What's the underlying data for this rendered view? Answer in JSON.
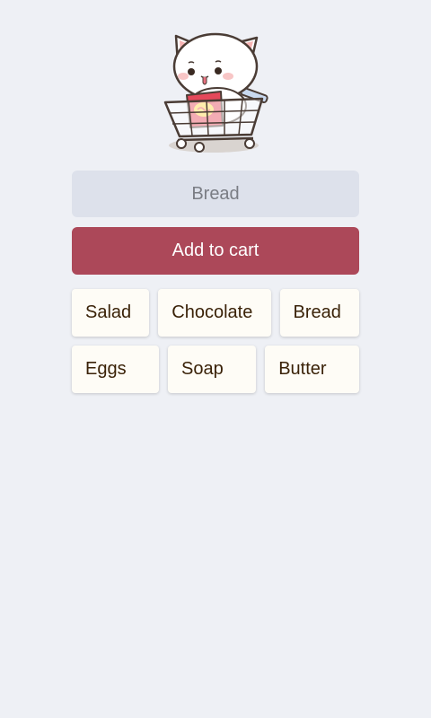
{
  "input": {
    "placeholder": "Bread",
    "value": ""
  },
  "add_button": {
    "label": "Add to cart"
  },
  "suggestions": [
    [
      "Salad",
      "Chocolate",
      "Bread"
    ],
    [
      "Eggs",
      "Soap",
      "Butter"
    ]
  ],
  "mascot": {
    "icon": "cat-in-shopping-cart-icon"
  },
  "colors": {
    "background": "#eef0f5",
    "input_bg": "#dde1eb",
    "accent": "#ac4859",
    "chip_bg": "#fefcf6",
    "chip_text": "#3a2208"
  }
}
